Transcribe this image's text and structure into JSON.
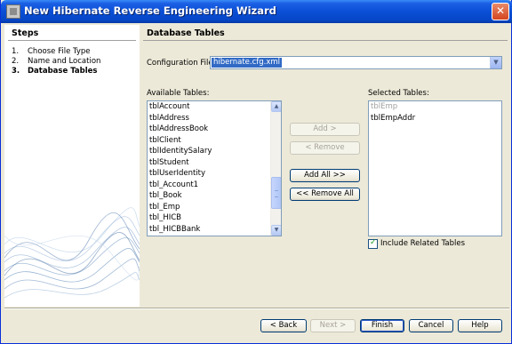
{
  "window": {
    "title": "New Hibernate Reverse Engineering Wizard",
    "close_glyph": "✕"
  },
  "steps": {
    "title": "Steps",
    "items": [
      {
        "num": "1.",
        "label": "Choose File Type"
      },
      {
        "num": "2.",
        "label": "Name and Location"
      },
      {
        "num": "3.",
        "label": "Database Tables"
      }
    ]
  },
  "main": {
    "title": "Database Tables",
    "config_label": "Configuration File:",
    "config_value": "hibernate.cfg.xml",
    "available_label": "Available Tables:",
    "selected_label": "Selected Tables:",
    "available_tables": [
      "tblAccount",
      "tblAddress",
      "tblAddressBook",
      "tblClient",
      "tblIdentitySalary",
      "tblStudent",
      "tblUserIdentity",
      "tbl_Account1",
      "tbl_Book",
      "tbl_Emp",
      "tbl_HICB",
      "tbl_HICBBank"
    ],
    "selected_tables": [
      {
        "name": "tblEmp",
        "disabled": true
      },
      {
        "name": "tblEmpAddr",
        "disabled": false
      }
    ],
    "buttons": {
      "add": "Add >",
      "remove": "< Remove",
      "add_all": "Add All >>",
      "remove_all": "<< Remove All"
    },
    "include_related": {
      "label": "Include Related Tables",
      "checked": true
    }
  },
  "footer": {
    "back": "< Back",
    "next": "Next >",
    "finish": "Finish",
    "cancel": "Cancel",
    "help": "Help"
  },
  "colors": {
    "titlebar": "#0a4fd6",
    "selection": "#316ac5",
    "dialog_bg": "#ece9d8"
  }
}
